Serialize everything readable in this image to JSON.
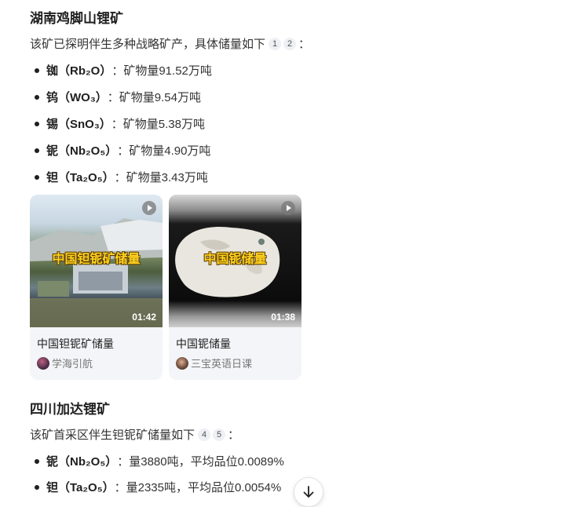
{
  "section1": {
    "title": "湖南鸡脚山锂矿",
    "intro": "该矿已探明伴生多种战略矿产，具体储量如下",
    "cites": [
      "1",
      "2"
    ],
    "colon": "：",
    "items": [
      {
        "name": "铷（Rb₂O）",
        "sep": "：",
        "value": "矿物量91.52万吨"
      },
      {
        "name": "钨（WO₃）",
        "sep": "：",
        "value": "矿物量9.54万吨"
      },
      {
        "name": "锡（SnO₃）",
        "sep": "：",
        "value": "矿物量5.38万吨"
      },
      {
        "name": "铌（Nb₂O₅）",
        "sep": "：",
        "value": "矿物量4.90万吨"
      },
      {
        "name": "钽（Ta₂O₅）",
        "sep": "：",
        "value": "矿物量3.43万吨"
      }
    ]
  },
  "videos": [
    {
      "overlay": "中国钽铌矿储量",
      "duration": "01:42",
      "title": "中国钽铌矿储量",
      "author": "学海引航",
      "icon": "play-icon"
    },
    {
      "overlay": "中国铌储量",
      "duration": "01:38",
      "title": "中国铌储量",
      "author": "三宝英语日课",
      "icon": "play-icon"
    }
  ],
  "section2": {
    "title": "四川加达锂矿",
    "intro": "该矿首采区伴生钽铌矿储量如下",
    "cites": [
      "4",
      "5"
    ],
    "colon": "：",
    "items": [
      {
        "name": "铌（Nb₂O₅）",
        "sep": "：",
        "value": "量3880吨，平均品位0.0089%"
      },
      {
        "name": "钽（Ta₂O₅）",
        "sep": "：",
        "value": "量2335吨，平均品位0.0054%"
      }
    ]
  },
  "scroll_button": {
    "icon": "arrow-down-icon"
  }
}
